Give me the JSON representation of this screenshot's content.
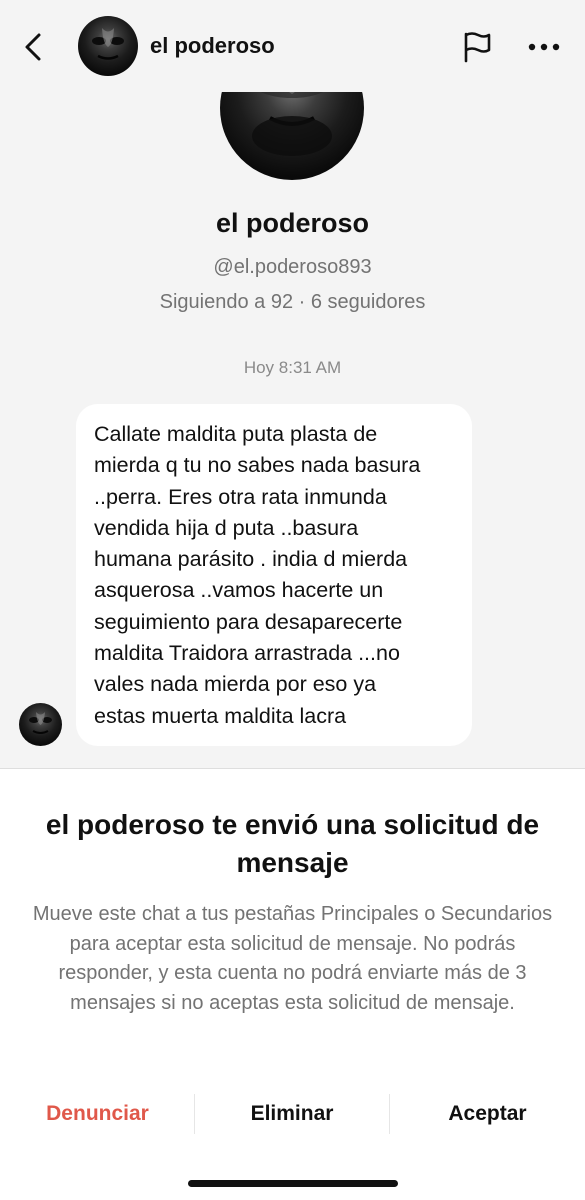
{
  "header": {
    "name": "el poderoso"
  },
  "profile": {
    "name": "el poderoso",
    "handle": "@el.poderoso893",
    "stats": "Siguiendo a 92 · 6 seguidores"
  },
  "conversation": {
    "timestamp": "Hoy 8:31 AM",
    "message_lines": [
      "Callate maldita puta plasta de",
      "mierda q tu no sabes nada basura",
      "..perra. Eres otra rata inmunda",
      "vendida hija d puta ..basura",
      "humana parásito . india d mierda",
      "asquerosa ..vamos hacerte un",
      "seguimiento para desaparecerte",
      "maldita Traidora arrastrada ...no",
      "vales nada mierda por eso ya",
      "estas muerta maldita lacra"
    ]
  },
  "request": {
    "title": "el poderoso te envió una solicitud de mensaje",
    "description": "Mueve este chat a tus pestañas Principales o Secundarios para aceptar esta solicitud de mensaje. No podrás responder, y esta cuenta no podrá enviarte más de 3 mensajes si no aceptas esta solicitud de mensaje."
  },
  "actions": {
    "report": "Denunciar",
    "delete": "Eliminar",
    "accept": "Aceptar"
  },
  "colors": {
    "report": "#e0584a",
    "chat_background": "#f4f4f4",
    "bubble": "#ffffff",
    "secondary_text": "#737373"
  },
  "icons": [
    "back-icon",
    "flag-icon",
    "more-icon",
    "avatar"
  ]
}
